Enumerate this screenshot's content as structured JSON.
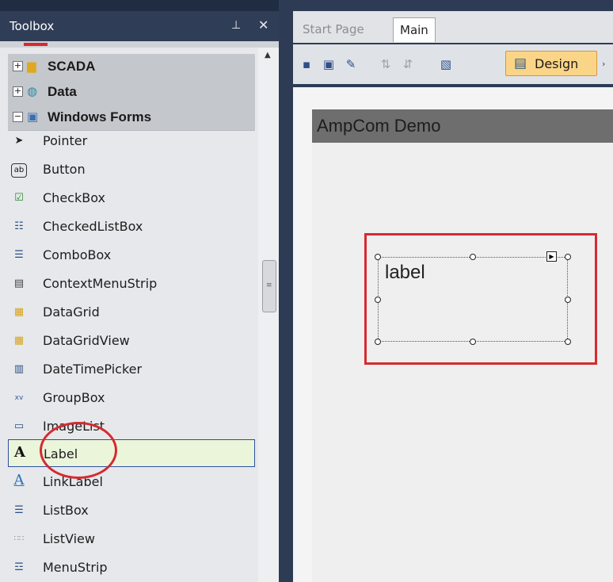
{
  "toolbox": {
    "title": "Toolbox",
    "pin_icon": "pin-icon",
    "close_icon": "close-icon",
    "categories": [
      {
        "label": "SCADA",
        "icon": "folder-icon",
        "expander": "+"
      },
      {
        "label": "Data",
        "icon": "data-icon",
        "expander": "+"
      },
      {
        "label": "Windows Forms",
        "icon": "windows-forms-icon",
        "expander": "−"
      }
    ],
    "items": [
      {
        "label": "Pointer",
        "icon": "pointer-icon"
      },
      {
        "label": "Button",
        "icon": "button-icon"
      },
      {
        "label": "CheckBox",
        "icon": "checkbox-icon"
      },
      {
        "label": "CheckedListBox",
        "icon": "checkedlistbox-icon"
      },
      {
        "label": "ComboBox",
        "icon": "combobox-icon"
      },
      {
        "label": "ContextMenuStrip",
        "icon": "contextmenustrip-icon"
      },
      {
        "label": "DataGrid",
        "icon": "datagrid-icon"
      },
      {
        "label": "DataGridView",
        "icon": "datagridview-icon"
      },
      {
        "label": "DateTimePicker",
        "icon": "datetimepicker-icon"
      },
      {
        "label": "GroupBox",
        "icon": "groupbox-icon"
      },
      {
        "label": "ImageList",
        "icon": "imagelist-icon"
      },
      {
        "label": "Label",
        "icon": "label-icon",
        "selected": true
      },
      {
        "label": "LinkLabel",
        "icon": "linklabel-icon"
      },
      {
        "label": "ListBox",
        "icon": "listbox-icon"
      },
      {
        "label": "ListView",
        "icon": "listview-icon"
      },
      {
        "label": "MenuStrip",
        "icon": "menustrip-icon"
      }
    ]
  },
  "designer": {
    "tabs": [
      {
        "label": "Start Page",
        "active": false
      },
      {
        "label": "Main",
        "active": true
      }
    ],
    "toolbar": {
      "design_label": "Design"
    },
    "form": {
      "title": "AmpCom Demo",
      "label_control_text": "label"
    }
  },
  "colors": {
    "accent_red": "#d52a2f",
    "selection_border": "#2d4fa0",
    "design_button": "#fbd587"
  }
}
